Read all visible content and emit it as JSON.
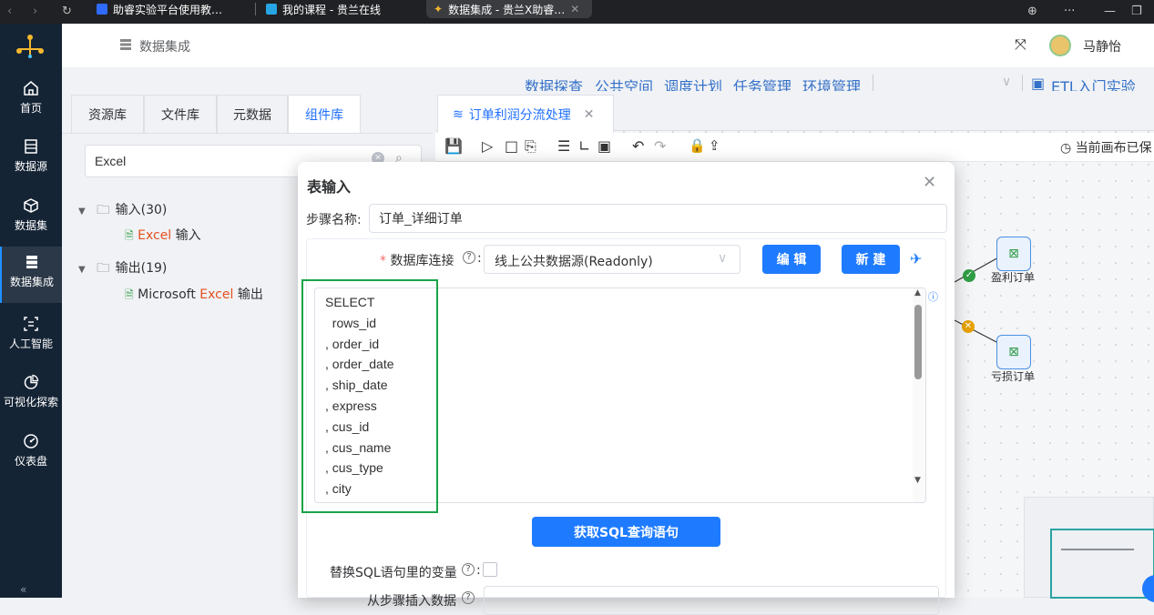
{
  "browser": {
    "tabs": [
      "助睿实验平台使用教…",
      "我的课程 - 贵兰在线",
      "数据集成 - 贵兰X助睿…"
    ]
  },
  "leftnav": {
    "items": [
      {
        "label": "首页",
        "icon": "home-icon"
      },
      {
        "label": "数据源",
        "icon": "database-icon"
      },
      {
        "label": "数据集",
        "icon": "cube-icon"
      },
      {
        "label": "数据集成",
        "icon": "server-icon"
      },
      {
        "label": "人工智能",
        "icon": "ai-icon"
      },
      {
        "label": "可视化探索",
        "icon": "pie-chart-icon"
      },
      {
        "label": "仪表盘",
        "icon": "dashboard-icon"
      }
    ]
  },
  "header": {
    "title": "数据集成",
    "user": "马静怡"
  },
  "subnav": {
    "links": [
      "数据探查",
      "公共空间",
      "调度计划",
      "任务管理",
      "环境管理"
    ],
    "project": "ETL入门实验"
  },
  "leftpanel": {
    "tabs": [
      "资源库",
      "文件库",
      "元数据",
      "组件库"
    ],
    "search_value": "Excel",
    "tree": {
      "input_group": "输入(30)",
      "input_item_prefix": "Excel",
      "input_item_suffix": " 输入",
      "output_group": "输出(19)",
      "output_item_prefix": "Microsoft ",
      "output_item_highlight": "Excel",
      "output_item_suffix": " 输出"
    }
  },
  "editor": {
    "tab_label": "订单利润分流处理",
    "save_status": "当前画布已保",
    "nodes": [
      "盈利订单",
      "亏损订单"
    ]
  },
  "dialog": {
    "title": "表输入",
    "step_name_label": "步骤名称:",
    "step_name_value": "订单_详细订单",
    "db_conn_label": "数据库连接",
    "db_conn_value": "线上公共数据源(Readonly)",
    "edit_button": "编 辑",
    "new_button": "新 建",
    "sql_lines": [
      "SELECT",
      "  rows_id",
      ", order_id",
      ", order_date",
      ", ship_date",
      ", express",
      ", cus_id",
      ", cus_name",
      ", cus_type",
      ", city"
    ],
    "get_sql_button": "获取SQL查询语句",
    "replace_var_label": "替换SQL语句里的变量",
    "insert_data_label": "从步骤插入数据"
  },
  "colors": {
    "accent": "#1e7bff",
    "nav_bg": "#152435",
    "highlight_box": "#1aa34a",
    "keyword": "#e6501e"
  }
}
